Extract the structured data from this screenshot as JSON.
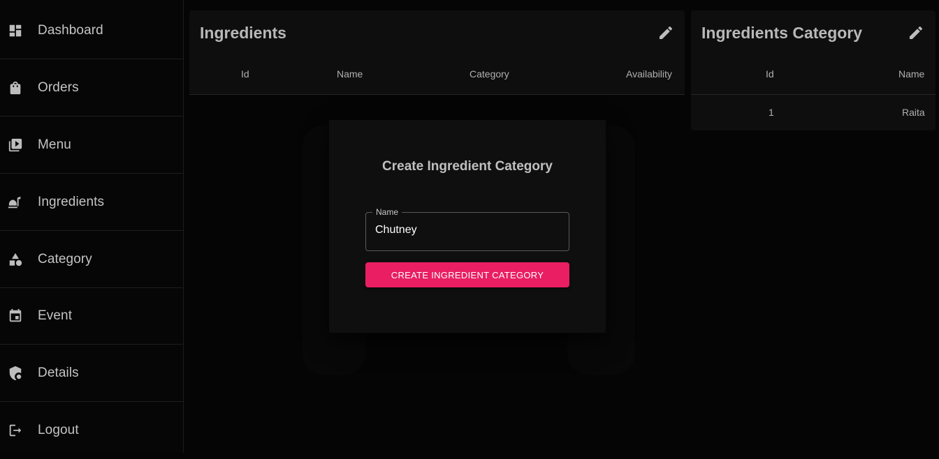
{
  "sidebar": {
    "items": [
      {
        "label": "Dashboard",
        "icon": "dashboard-icon"
      },
      {
        "label": "Orders",
        "icon": "shopping-bag-icon"
      },
      {
        "label": "Menu",
        "icon": "menu-book-icon"
      },
      {
        "label": "Ingredients",
        "icon": "ingredients-icon"
      },
      {
        "label": "Category",
        "icon": "category-icon"
      },
      {
        "label": "Event",
        "icon": "event-icon"
      },
      {
        "label": "Details",
        "icon": "shield-icon"
      },
      {
        "label": "Logout",
        "icon": "logout-icon"
      }
    ]
  },
  "ingredients_panel": {
    "title": "Ingredients",
    "columns": [
      "Id",
      "Name",
      "Category",
      "Availability"
    ],
    "rows": []
  },
  "category_panel": {
    "title": "Ingredients Category",
    "columns": [
      "Id",
      "Name"
    ],
    "rows": [
      {
        "id": "1",
        "name": "Raita"
      }
    ]
  },
  "dialog": {
    "title": "Create Ingredient Category",
    "field_label": "Name",
    "field_value": "Chutney",
    "button_label": "CREATE INGREDIENT CATEGORY"
  },
  "colors": {
    "accent": "#e91e63",
    "background": "#050505",
    "panel": "#0e0e0e"
  }
}
